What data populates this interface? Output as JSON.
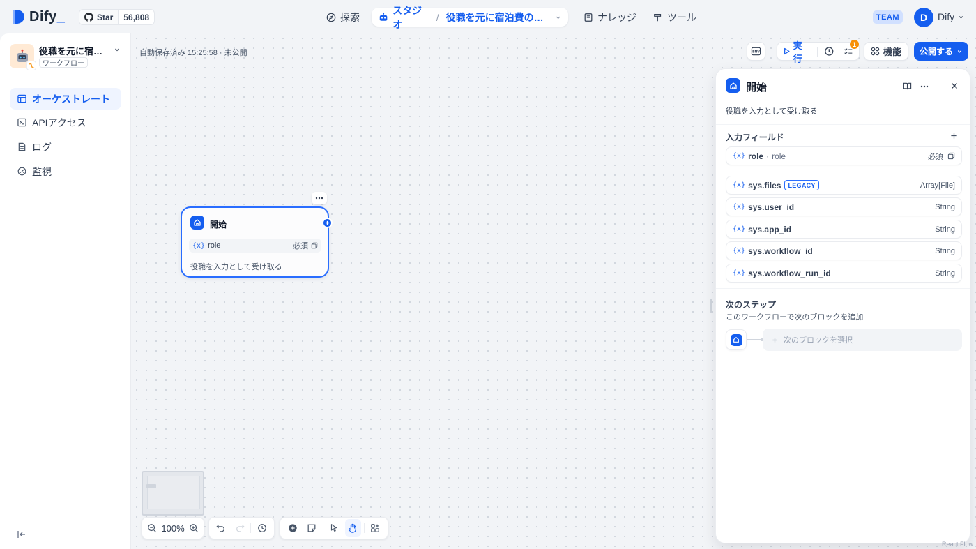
{
  "brand": {
    "logo_text": "Dify",
    "logo_suffix": "_"
  },
  "github": {
    "star_label": "Star",
    "star_count": "56,808"
  },
  "nav": {
    "explore": "探索",
    "studio": "スタジオ",
    "app_name": "役職を元に宿泊費の目安…",
    "knowledge": "ナレッジ",
    "tools": "ツール"
  },
  "account": {
    "team_badge": "TEAM",
    "avatar_initial": "D",
    "name": "Dify"
  },
  "sidebar": {
    "app_title": "役職を元に宿泊...",
    "app_type": "ワークフロー",
    "items": [
      {
        "label": "オーケストレート",
        "icon": "orchestrate-icon",
        "active": true
      },
      {
        "label": "APIアクセス",
        "icon": "terminal-icon",
        "active": false
      },
      {
        "label": "ログ",
        "icon": "log-icon",
        "active": false
      },
      {
        "label": "監視",
        "icon": "monitor-icon",
        "active": false
      }
    ]
  },
  "canvas": {
    "autosave_status": "自動保存済み 15:25:58 · 未公開"
  },
  "toolbar": {
    "env_label": "ENV",
    "run_label": "実行",
    "checklist_badge": "1",
    "features_label": "機能",
    "publish_label": "公開する"
  },
  "node": {
    "title": "開始",
    "var_name": "role",
    "var_required": "必須",
    "description": "役職を入力として受け取る"
  },
  "zoom": {
    "level": "100%"
  },
  "panel": {
    "title": "開始",
    "description": "役職を入力として受け取る",
    "input_section_title": "入力フィールド",
    "user_fields": [
      {
        "name": "role",
        "label": "role",
        "required": "必須"
      }
    ],
    "system_fields": [
      {
        "name": "sys.files",
        "badge": "LEGACY",
        "type": "Array[File]"
      },
      {
        "name": "sys.user_id",
        "badge": "",
        "type": "String"
      },
      {
        "name": "sys.app_id",
        "badge": "",
        "type": "String"
      },
      {
        "name": "sys.workflow_id",
        "badge": "",
        "type": "String"
      },
      {
        "name": "sys.workflow_run_id",
        "badge": "",
        "type": "String"
      }
    ],
    "next_step_title": "次のステップ",
    "next_step_description": "このワークフローで次のブロックを追加",
    "next_block_placeholder": "次のブロックを選択"
  },
  "watermark": "React Flow",
  "colors": {
    "accent": "#155eef",
    "badge_orange": "#f79009",
    "node_border": "#296dff"
  }
}
